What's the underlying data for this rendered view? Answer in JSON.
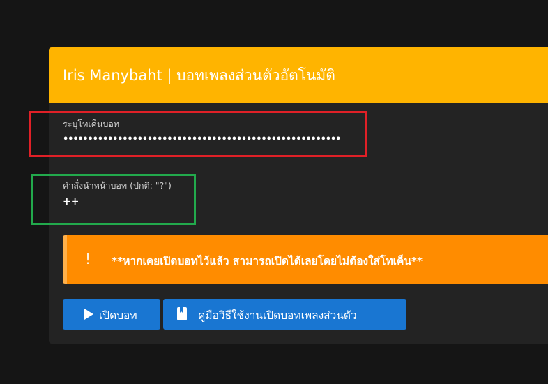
{
  "header": {
    "title": "Iris Manybaht | บอทเพลงส่วนตัวอัตโนมัติ"
  },
  "token_field": {
    "label": "ระบุโทเค็นบอท",
    "value": "••••••••••••••••••••••••••••••••••••••••••••••••••••••••••••"
  },
  "prefix_field": {
    "label": "คำสั่งนำหน้าบอท (ปกติ: \"?\")",
    "value": "++"
  },
  "alert": {
    "icon": "exclamation-icon",
    "icon_glyph": "!",
    "text": "**หากเคยเปิดบอทไว้แล้ว สามารถเปิดได้เลยโดยไม่ต้องใส่โทเค็น**"
  },
  "buttons": {
    "open_label": "เปิดบอท",
    "guide_label": "คู่มือวิธีใช้งานเปิดบอทเพลงส่วนตัว"
  },
  "colors": {
    "header": "#ffb400",
    "alert": "#ff8c00",
    "button": "#1976d2",
    "highlight_red": "#e02027",
    "highlight_green": "#22a94c"
  }
}
